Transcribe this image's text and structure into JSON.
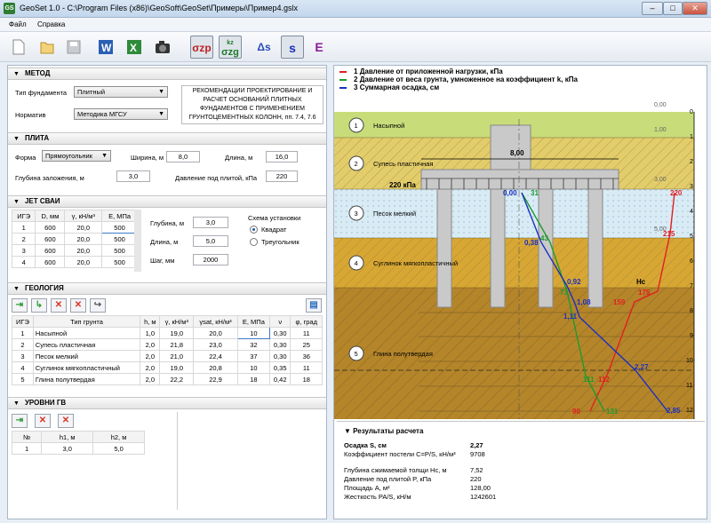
{
  "window": {
    "title": "GeoSet 1.0 - C:\\Program Files (x86)\\GeoSoft\\GeoSet\\Примеры\\Пример4.gslx",
    "app_icon": "GS",
    "minimize": "–",
    "maximize": "□",
    "close": "✕"
  },
  "menu": [
    "Файл",
    "Справка"
  ],
  "toolbar": {
    "sigma_zp": "σzp",
    "sigma_zg_top": "kz",
    "sigma_zg": "σzg",
    "delta_s": "Δs",
    "s": "s",
    "e": "E"
  },
  "metod": {
    "title": "МЕТОД",
    "foundation_type_label": "Тип фундамента",
    "foundation_type_value": "Плитный",
    "norm_label": "Норматив",
    "norm_value": "Методика МГСУ",
    "note": "РЕКОМЕНДАЦИИ ПРОЕКТИРОВАНИЕ И РАСЧЕТ ОСНОВАНИЙ ПЛИТНЫХ ФУНДАМЕНТОВ С ПРИМЕНЕНИЕМ ГРУНТОЦЕМЕНТНЫХ КОЛОНН, пп. 7.4, 7.6"
  },
  "plita": {
    "title": "ПЛИТА",
    "form_label": "Форма",
    "form_value": "Прямоугольник",
    "width_label": "Ширина, м",
    "width_value": "8,0",
    "length_label": "Длина, м",
    "length_value": "16,0",
    "depth_label": "Глубина заложения, м",
    "depth_value": "3,0",
    "pressure_label": "Давление под плитой, кПа",
    "pressure_value": "220"
  },
  "jet": {
    "title": "JET СВАИ",
    "headers": [
      "ИГЭ",
      "D, мм",
      "γ, кН/м³",
      "E, МПа"
    ],
    "rows": [
      [
        "1",
        "600",
        "20,0",
        "500"
      ],
      [
        "2",
        "600",
        "20,0",
        "500"
      ],
      [
        "3",
        "600",
        "20,0",
        "500"
      ],
      [
        "4",
        "600",
        "20,0",
        "500"
      ]
    ],
    "depth_label": "Глубина, м",
    "depth_value": "3,0",
    "length_label": "Длина, м",
    "length_value": "5,0",
    "step_label": "Шаг, мм",
    "step_value": "2000",
    "scheme_label": "Схема установки",
    "scheme_options": [
      "Квадрат",
      "Треугольник"
    ],
    "scheme_selected": "Квадрат"
  },
  "geology": {
    "title": "ГЕОЛОГИЯ",
    "headers": [
      "ИГЭ",
      "Тип грунта",
      "h, м",
      "γ, кН/м³",
      "γsat, кН/м³",
      "E, МПа",
      "ν",
      "φ, град"
    ],
    "rows": [
      [
        "1",
        "Насыпной",
        "1,0",
        "19,0",
        "20,0",
        "10",
        "0,30",
        "11"
      ],
      [
        "2",
        "Супесь пластичная",
        "2,0",
        "21,8",
        "23,0",
        "32",
        "0,30",
        "25"
      ],
      [
        "3",
        "Песок мелкий",
        "2,0",
        "21,0",
        "22,4",
        "37",
        "0,30",
        "36"
      ],
      [
        "4",
        "Суглинок мягкопластичный",
        "2,0",
        "19,0",
        "20,8",
        "10",
        "0,35",
        "11"
      ],
      [
        "5",
        "Глина полутвердая",
        "2,0",
        "22,2",
        "22,9",
        "18",
        "0,42",
        "18"
      ]
    ]
  },
  "gw": {
    "title": "УРОВНИ ГВ",
    "headers": [
      "№",
      "h1, м",
      "h2, м"
    ],
    "rows": [
      [
        "1",
        "3,0",
        "5,0"
      ]
    ]
  },
  "legend": [
    {
      "num": "1",
      "text": "Давление от приложенной нагрузки, кПа",
      "color": "#e02020"
    },
    {
      "num": "2",
      "text": "Давление от веса грунта, умноженное на коэффициент k, кПа",
      "color": "#1f9a2e"
    },
    {
      "num": "3",
      "text": "Суммарная осадка, см",
      "color": "#1c2fc0"
    }
  ],
  "diagram": {
    "layers": [
      "Насыпной",
      "Супесь пластичная",
      "Песок мелкий",
      "Суглинок мягкопластичный",
      "Глина полутвердая"
    ],
    "layer_nums": [
      "1",
      "2",
      "3",
      "4",
      "5"
    ],
    "plate_width": "8,00",
    "load": "220 кПа",
    "hc": "Hc",
    "depth_ticks": [
      "0",
      "1",
      "2",
      "3",
      "4",
      "5",
      "6",
      "7",
      "8",
      "9",
      "10",
      "11",
      "12"
    ],
    "level_marks": [
      "0,00",
      "1,00",
      "3,00",
      "5,00"
    ],
    "red_labels": [
      "220",
      "215",
      "175",
      "159",
      "112",
      "90"
    ],
    "green_labels": [
      "31",
      "43",
      "73",
      "111",
      "131"
    ],
    "blue_labels": [
      "0,00",
      "0,38",
      "0,92",
      "1,08",
      "1,11",
      "2,27",
      "2,85"
    ]
  },
  "results": {
    "title": "Результаты расчета",
    "rows": [
      {
        "k": "Осадка S, см",
        "v": "2,27",
        "bold": true
      },
      {
        "k": "Коэффициент постели C=P/S, кН/м³",
        "v": "9708"
      },
      {
        "k": "Глубина сжимаемой толщи Hc, м",
        "v": "7,52"
      },
      {
        "k": "Давление под плитой P, кПа",
        "v": "220"
      },
      {
        "k": "Площадь A, м²",
        "v": "128,00"
      },
      {
        "k": "Жесткость PA/S, кН/м",
        "v": "1242601"
      }
    ]
  }
}
